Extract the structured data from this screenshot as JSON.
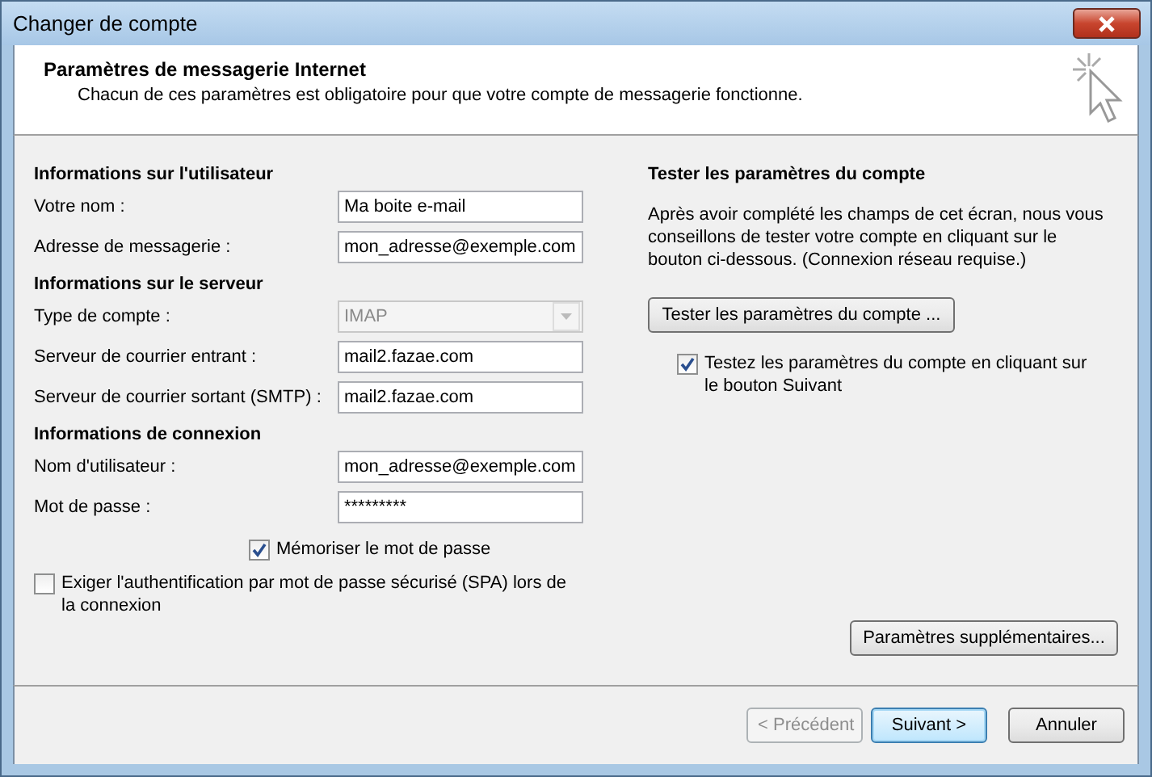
{
  "window": {
    "title": "Changer de compte"
  },
  "header": {
    "title": "Paramètres de messagerie Internet",
    "subtitle": "Chacun de ces paramètres est obligatoire pour que votre compte de messagerie fonctionne."
  },
  "sections": [
    {
      "heading": "Informations sur l'utilisateur",
      "fields": [
        {
          "kind": "text",
          "label": "Votre nom :",
          "value": "Ma boite e-mail",
          "disabled": false
        },
        {
          "kind": "text",
          "label": "Adresse de messagerie :",
          "value": "mon_adresse@exemple.com",
          "disabled": false
        }
      ]
    },
    {
      "heading": "Informations sur le serveur",
      "fields": [
        {
          "kind": "select",
          "label": "Type de compte :",
          "value": "IMAP",
          "disabled": true
        },
        {
          "kind": "text",
          "label": "Serveur de courrier entrant :",
          "value": "mail2.fazae.com",
          "disabled": false
        },
        {
          "kind": "text",
          "label": "Serveur de courrier sortant (SMTP) :",
          "value": "mail2.fazae.com",
          "disabled": false
        }
      ]
    },
    {
      "heading": "Informations de connexion",
      "fields": [
        {
          "kind": "text",
          "label": "Nom d'utilisateur :",
          "value": "mon_adresse@exemple.com",
          "disabled": false
        },
        {
          "kind": "text",
          "label": "Mot de passe :",
          "value": "*********",
          "disabled": false
        }
      ]
    }
  ],
  "remember_password": {
    "label": "Mémoriser le mot de passe",
    "checked": true
  },
  "require_spa": {
    "label": "Exiger l'authentification par mot de passe sécurisé (SPA) lors de la connexion",
    "checked": false
  },
  "test": {
    "heading": "Tester les paramètres du compte",
    "description": "Après avoir complété les champs de cet écran, nous vous conseillons de tester votre compte en cliquant sur le bouton ci-dessous. (Connexion réseau requise.)",
    "button": "Tester les paramètres du compte ...",
    "auto_test": {
      "label": "Testez les paramètres du compte en cliquant sur le bouton Suivant",
      "checked": true
    }
  },
  "more_settings_button": "Paramètres supplémentaires...",
  "footer_buttons": [
    {
      "label": "< Précédent",
      "disabled": true,
      "default": false
    },
    {
      "label": "Suivant >",
      "disabled": false,
      "default": true
    },
    {
      "label": "Annuler",
      "disabled": false,
      "default": false
    }
  ]
}
